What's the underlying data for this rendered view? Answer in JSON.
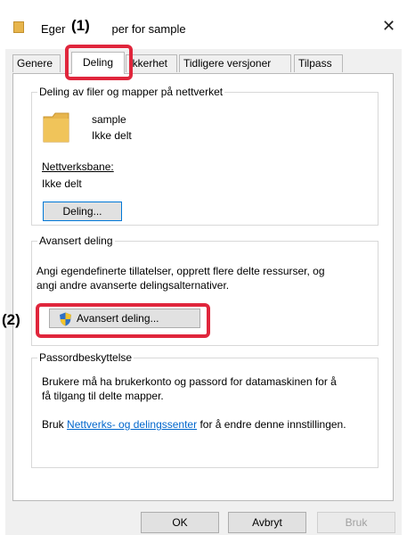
{
  "window": {
    "title_prefix": "Eger",
    "title_suffix": "per for sample",
    "close_glyph": "✕"
  },
  "tabs": [
    {
      "label": "Genere",
      "active": false
    },
    {
      "label": "Deling",
      "active": true
    },
    {
      "label": "ikkerhet",
      "active": false
    },
    {
      "label": "Tidligere versjoner",
      "active": false
    },
    {
      "label": "Tilpass",
      "active": false
    }
  ],
  "network_sharing": {
    "group_title": "Deling av filer og mapper på nettverket",
    "item_name": "sample",
    "item_status": "Ikke delt",
    "path_label": "Nettverksbane:",
    "path_value": "Ikke delt",
    "share_button": "Deling..."
  },
  "advanced_sharing": {
    "group_title": "Avansert deling",
    "description_line1": "Angi egendefinerte tillatelser, opprett flere delte ressurser, og",
    "description_line2": "angi andre avanserte delingsalternativer.",
    "button": "Avansert deling..."
  },
  "password_protection": {
    "group_title": "Passordbeskyttelse",
    "line1": "Brukere må ha brukerkonto og passord for datamaskinen for å",
    "line2": "få tilgang til delte mapper.",
    "prefix": "Bruk",
    "link": "Nettverks- og delingssenter",
    "suffix": "for å endre denne innstillingen."
  },
  "footer": {
    "ok": "OK",
    "cancel": "Avbryt",
    "apply": "Bruk"
  },
  "callouts": {
    "one": "(1)",
    "two": "(2)"
  },
  "colors": {
    "highlight": "#e0263c",
    "link": "#0066cc",
    "folder": "#e7b54c"
  }
}
